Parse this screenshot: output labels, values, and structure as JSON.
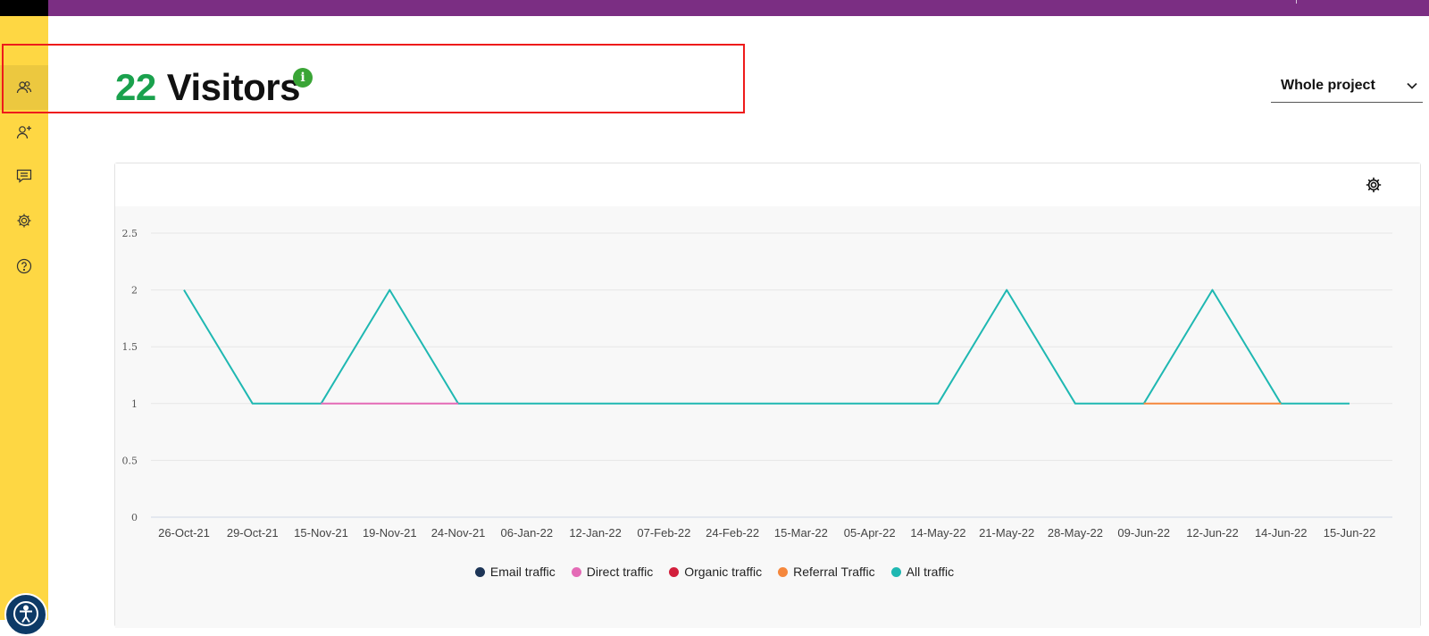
{
  "page": {
    "visitor_count": "22",
    "visitor_label": "Visitors",
    "info_glyph": "i",
    "scope_select": {
      "value": "Whole project"
    }
  },
  "sidebar": {
    "items": [
      {
        "icon": "visitors-icon",
        "active": true
      },
      {
        "icon": "add-user-icon",
        "active": false
      },
      {
        "icon": "comments-icon",
        "active": false
      },
      {
        "icon": "settings-icon",
        "active": false
      },
      {
        "icon": "help-icon",
        "active": false
      }
    ],
    "accessibility_icon": "accessibility-icon"
  },
  "colors": {
    "brand_purple": "#7b2e83",
    "sidebar_yellow": "#fed743",
    "count_green": "#1aa14d",
    "info_green": "#3aa536",
    "highlight_red": "#ee1b1b"
  },
  "chart_data": {
    "type": "line",
    "categories": [
      "26-Oct-21",
      "29-Oct-21",
      "15-Nov-21",
      "19-Nov-21",
      "24-Nov-21",
      "06-Jan-22",
      "12-Jan-22",
      "07-Feb-22",
      "24-Feb-22",
      "15-Mar-22",
      "05-Apr-22",
      "14-May-22",
      "21-May-22",
      "28-May-22",
      "09-Jun-22",
      "12-Jun-22",
      "14-Jun-22",
      "15-Jun-22"
    ],
    "y_ticks": [
      "0",
      "0.5",
      "1",
      "1.5",
      "2",
      "2.5"
    ],
    "ylim": [
      0,
      2.5
    ],
    "grid": true,
    "legend_position": "bottom",
    "series": [
      {
        "name": "Email traffic",
        "color": "#1d3557",
        "values": [
          null,
          null,
          null,
          null,
          null,
          null,
          null,
          null,
          null,
          null,
          null,
          null,
          null,
          null,
          null,
          null,
          null,
          null
        ]
      },
      {
        "name": "Direct traffic",
        "color": "#e46bb6",
        "values": [
          null,
          null,
          1,
          1,
          1,
          null,
          null,
          null,
          null,
          null,
          null,
          null,
          null,
          null,
          null,
          null,
          null,
          null
        ]
      },
      {
        "name": "Organic traffic",
        "color": "#d21f3c",
        "values": [
          null,
          null,
          null,
          null,
          null,
          null,
          null,
          null,
          null,
          null,
          null,
          null,
          null,
          null,
          null,
          null,
          null,
          null
        ]
      },
      {
        "name": "Referral Traffic",
        "color": "#f5873c",
        "values": [
          null,
          null,
          null,
          null,
          null,
          null,
          null,
          null,
          null,
          null,
          null,
          null,
          null,
          null,
          1,
          1,
          1,
          null
        ]
      },
      {
        "name": "All traffic",
        "color": "#1fb8b2",
        "values": [
          2,
          1,
          1,
          2,
          1,
          1,
          1,
          1,
          1,
          1,
          1,
          1,
          2,
          1,
          1,
          2,
          1,
          1
        ]
      }
    ]
  }
}
